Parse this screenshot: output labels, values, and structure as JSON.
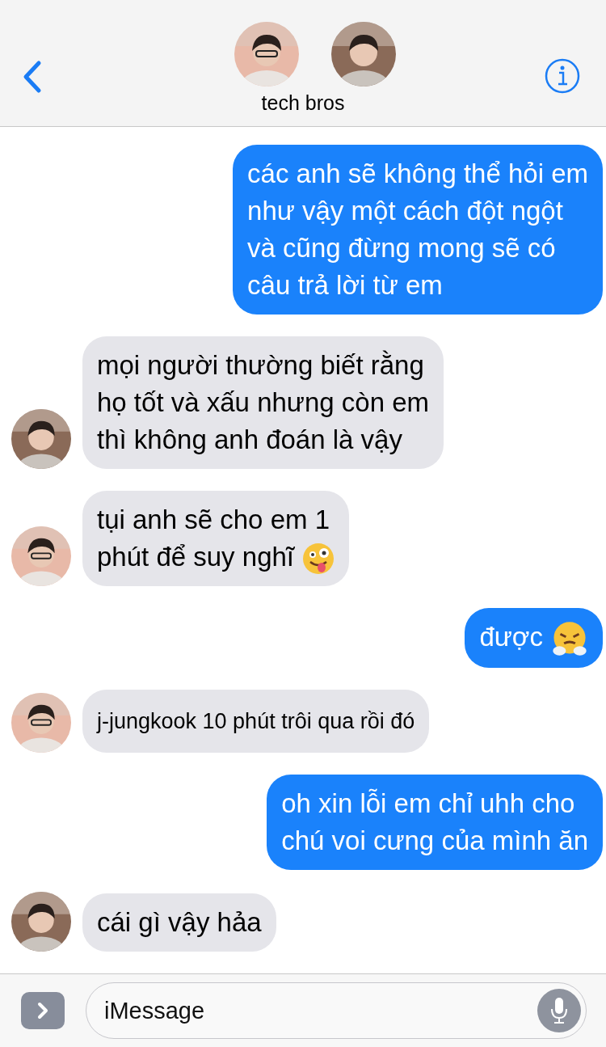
{
  "header": {
    "title": "tech bros",
    "avatars": [
      {
        "kind": "glasses"
      },
      {
        "kind": "plain"
      }
    ]
  },
  "messages": [
    {
      "kind": "sent",
      "lines": [
        "các anh sẽ không thể hỏi em",
        "như vậy một cách đột ngột",
        "và cũng đừng mong sẽ có",
        "câu trả lời từ em"
      ]
    },
    {
      "kind": "received",
      "avatar": {
        "kind": "plain"
      },
      "lines": [
        "mọi người thường biết rằng",
        "họ tốt và xấu nhưng còn em",
        "thì không anh đoán là vậy"
      ]
    },
    {
      "kind": "received",
      "avatar": {
        "kind": "glasses"
      },
      "emoji": {
        "kind": "zany"
      },
      "lines": [
        "tụi anh sẽ cho em 1",
        "phút để suy nghĩ"
      ]
    },
    {
      "kind": "sent",
      "emoji": {
        "kind": "steam"
      },
      "lines": [
        "được"
      ]
    },
    {
      "kind": "received",
      "avatar": {
        "kind": "glasses"
      },
      "small": true,
      "lines": [
        "j-jungkook 10 phút trôi qua rồi đó"
      ]
    },
    {
      "kind": "sent",
      "lines": [
        "oh xin lỗi em chỉ uhh cho",
        "chú voi cưng của mình ăn"
      ]
    },
    {
      "kind": "received",
      "avatar": {
        "kind": "plain"
      },
      "lines": [
        "cái gì vậy hảa"
      ]
    }
  ],
  "composer": {
    "placeholder": "iMessage"
  }
}
